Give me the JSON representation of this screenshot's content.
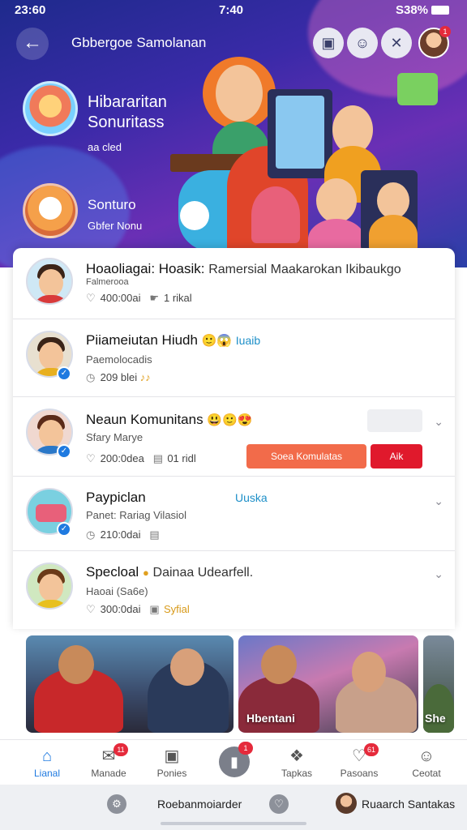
{
  "status": {
    "time_left": "23:60",
    "time_center": "7:40",
    "battery": "S38%"
  },
  "topbar": {
    "title": "Gbbergoe Samolanan",
    "back_icon": "arrow-left-icon",
    "actions": [
      "camera-icon",
      "user-icon",
      "close-icon"
    ],
    "avatar_badge": "1"
  },
  "hero": {
    "items": [
      {
        "title_line1": "Hibararitan",
        "title_line2": "Sonuritass",
        "sub": "aa cled"
      },
      {
        "title_line1": "Sonturo",
        "title_line2": "",
        "sub": "Gbfer Nonu"
      }
    ]
  },
  "list": [
    {
      "name": "Hoaoliagai: Hoasik:",
      "name_extra": "Ramersial Maakarokan Ikibaukgo",
      "sub": "Falmerooa",
      "count": "400:00ai",
      "extra": "1 rikal"
    },
    {
      "name": "Piiameiutan Hiudh",
      "tag": "Iuaib",
      "sub": "Paemolocadis",
      "count": "209 blei",
      "extra": ""
    },
    {
      "name": "Neaun Komunitans",
      "sub": "Sfary Marye",
      "count": "200:0dea",
      "extra": "01 ridl",
      "btn_primary": "Soea Komulatas",
      "btn_secondary": "Aik"
    },
    {
      "name": "Paypiclan",
      "tag": "Uuska",
      "sub": "Panet: Rariag Vilasiol",
      "count": "210:0dai",
      "extra": ""
    },
    {
      "name": "Specloal",
      "name_extra": "Dainaa Udearfell.",
      "sub": "Haoai (Sa6e)",
      "count": "300:0dai",
      "extra": "Syfial"
    }
  ],
  "photos": [
    {
      "caption": ""
    },
    {
      "caption": "Hbentani"
    },
    {
      "caption": "She"
    }
  ],
  "nav": {
    "items": [
      {
        "label": "Lianal",
        "icon": "home-icon",
        "badge": ""
      },
      {
        "label": "Manade",
        "icon": "chat-icon",
        "badge": "11"
      },
      {
        "label": "Ponies",
        "icon": "photo-icon",
        "badge": ""
      },
      {
        "label": "Tapkas",
        "icon": "tag-icon",
        "badge": ""
      },
      {
        "label": "Pasoans",
        "icon": "heart-icon",
        "badge": "61"
      },
      {
        "label": "Ceotat",
        "icon": "profile-icon",
        "badge": ""
      }
    ],
    "center_badge": "1"
  },
  "sysbar": {
    "text_left": "Roebanmoiarder",
    "text_right": "Ruaarch Santakas"
  },
  "colors": {
    "accent": "#1f7ae0",
    "orange": "#f26b4a",
    "red": "#e0192c",
    "hero_start": "#1e2a8c",
    "hero_end": "#6a2fb5"
  }
}
